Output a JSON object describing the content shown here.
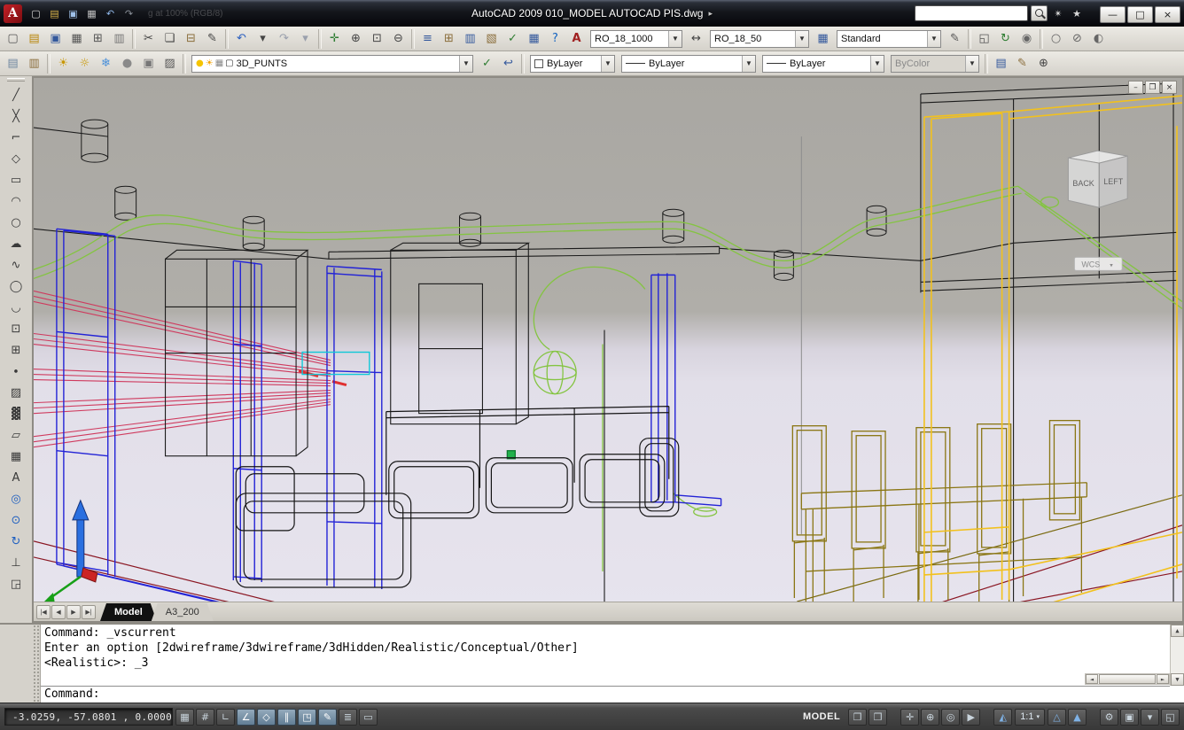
{
  "titlebar": {
    "title": "AutoCAD 2009 010_MODEL AUTOCAD PIS.dwg",
    "title_arrow": "▸",
    "background_text": "g at 100% (RGB/8)",
    "search_value": "",
    "qat": [
      {
        "name": "qnew-icon",
        "glyph": "▢",
        "color": "#d8d8d8"
      },
      {
        "name": "open-icon",
        "glyph": "▤",
        "color": "#d8b24a"
      },
      {
        "name": "save-icon",
        "glyph": "▣",
        "color": "#9fc0e8"
      },
      {
        "name": "plot-icon",
        "glyph": "▦",
        "color": "#c0c0c0"
      },
      {
        "name": "undo-icon",
        "glyph": "↶",
        "color": "#8fb6e8"
      },
      {
        "name": "redo-icon",
        "glyph": "↷",
        "color": "#8a8f98"
      }
    ],
    "comm_center_glyph": "✴",
    "favorites_glyph": "★",
    "window_buttons": [
      {
        "name": "minimize-button",
        "glyph": "—"
      },
      {
        "name": "maximize-button",
        "glyph": "□"
      },
      {
        "name": "close-button",
        "glyph": "×"
      }
    ]
  },
  "toolbar1": {
    "left_icons": [
      {
        "name": "qnew-icon",
        "glyph": "▢",
        "color": "#555555"
      },
      {
        "name": "open-icon",
        "glyph": "▤",
        "color": "#b8860b"
      },
      {
        "name": "save-icon",
        "glyph": "▣",
        "color": "#33589c"
      },
      {
        "name": "plot-icon",
        "glyph": "▦",
        "color": "#555555"
      },
      {
        "name": "plot-preview-icon",
        "glyph": "⊞",
        "color": "#555555"
      },
      {
        "name": "publish-icon",
        "glyph": "▥",
        "color": "#777777"
      },
      {
        "sep": true
      },
      {
        "name": "cut-icon",
        "glyph": "✂",
        "color": "#444444"
      },
      {
        "name": "copy-icon",
        "glyph": "❏",
        "color": "#444444"
      },
      {
        "name": "paste-icon",
        "glyph": "⊟",
        "color": "#8a6d3b"
      },
      {
        "name": "match-properties-icon",
        "glyph": "✎",
        "color": "#444444"
      },
      {
        "sep": true
      },
      {
        "name": "undo-icon",
        "glyph": "↶",
        "color": "#2b5fbf"
      },
      {
        "name": "undo-dropdown-icon",
        "glyph": "▾",
        "color": "#444444"
      },
      {
        "name": "redo-icon",
        "glyph": "↷",
        "color": "#9aa0ad"
      },
      {
        "name": "redo-dropdown-icon",
        "glyph": "▾",
        "color": "#9aa0ad"
      },
      {
        "sep": true
      },
      {
        "name": "pan-icon",
        "glyph": "✛",
        "color": "#2e7d32"
      },
      {
        "name": "zoom-realtime-icon",
        "glyph": "⊕",
        "color": "#444444"
      },
      {
        "name": "zoom-window-icon",
        "glyph": "⊡",
        "color": "#444444"
      },
      {
        "name": "zoom-previous-icon",
        "glyph": "⊖",
        "color": "#444444"
      },
      {
        "sep": true
      },
      {
        "name": "properties-icon",
        "glyph": "≡",
        "color": "#33589c"
      },
      {
        "name": "designcenter-icon",
        "glyph": "⊞",
        "color": "#8a6d3b"
      },
      {
        "name": "tool-palettes-icon",
        "glyph": "▥",
        "color": "#33589c"
      },
      {
        "name": "sheet-set-manager-icon",
        "glyph": "▧",
        "color": "#8a6d3b"
      },
      {
        "name": "markup-icon",
        "glyph": "✓",
        "color": "#2e7d32"
      },
      {
        "name": "quickcalc-icon",
        "glyph": "▦",
        "color": "#33589c"
      },
      {
        "name": "help-icon",
        "glyph": "?",
        "color": "#1565c0"
      }
    ],
    "text_style_icon": "A",
    "text_style_value": "RO_18_1000",
    "dim_style_icon": "↔",
    "dim_style_value": "RO_18_50",
    "table_style_icon": "▦",
    "table_style_value": "Standard",
    "right_icons": [
      {
        "name": "dim-update-icon",
        "glyph": "✎",
        "color": "#555555"
      },
      {
        "sep": true
      },
      {
        "name": "named-views-icon",
        "glyph": "◱",
        "color": "#555555"
      },
      {
        "name": "3d-orbit-icon",
        "glyph": "↻",
        "color": "#2e7d32"
      },
      {
        "name": "render-icon",
        "glyph": "◉",
        "color": "#666666"
      },
      {
        "sep": true
      },
      {
        "name": "sphere-icon",
        "glyph": "○",
        "color": "#666666"
      },
      {
        "name": "no-shadow-icon",
        "glyph": "⊘",
        "color": "#666666"
      },
      {
        "name": "materials-icon",
        "glyph": "◐",
        "color": "#666666"
      }
    ]
  },
  "toolbar2": {
    "left_icons": [
      {
        "name": "layer-properties-manager-icon",
        "glyph": "▤",
        "color": "#6f87a0"
      },
      {
        "name": "layer-states-manager-icon",
        "glyph": "▥",
        "color": "#8a6d3b"
      },
      {
        "sep": true
      },
      {
        "name": "layer-isolate-icon",
        "glyph": "☀",
        "color": "#c89600"
      },
      {
        "name": "layer-unisolate-icon",
        "glyph": "☼",
        "color": "#c89600"
      },
      {
        "name": "layer-freeze-icon",
        "glyph": "❄",
        "color": "#4a90d9"
      },
      {
        "name": "layer-off-icon",
        "glyph": "●",
        "color": "#8a8a8a"
      },
      {
        "name": "layer-lock-icon",
        "glyph": "▣",
        "color": "#777777"
      },
      {
        "name": "layer-walk-icon",
        "glyph": "▨",
        "color": "#555555"
      },
      {
        "sep": true
      }
    ],
    "layer_combo": {
      "icons": [
        {
          "name": "bulb-on-icon",
          "glyph": "●",
          "color": "#f5c400"
        },
        {
          "name": "sun-icon",
          "glyph": "☀",
          "color": "#f5a300"
        },
        {
          "name": "plot-state-icon",
          "glyph": "▦",
          "color": "#888888"
        },
        {
          "name": "layer-color-swatch",
          "glyph": "▢",
          "color": "#333333"
        }
      ],
      "value": "3D_PUNTS"
    },
    "mid_icons": [
      {
        "name": "make-object-layer-current-icon",
        "glyph": "✓",
        "color": "#2e7d32"
      },
      {
        "name": "layer-previous-icon",
        "glyph": "↩",
        "color": "#33589c"
      },
      {
        "sep": true
      }
    ],
    "color_value": "ByLayer",
    "linetype_value": "ByLayer",
    "lineweight_value": "ByLayer",
    "plotstyle_value": "ByColor",
    "right_icons": [
      {
        "sep": true
      },
      {
        "name": "properties-palette-icon",
        "glyph": "▤",
        "color": "#33589c"
      },
      {
        "name": "match-layer-icon",
        "glyph": "✎",
        "color": "#8a6d3b"
      },
      {
        "name": "zoom-to-object-icon",
        "glyph": "⊕",
        "color": "#444444"
      }
    ]
  },
  "left_toolbar": {
    "items": [
      {
        "name": "line-icon",
        "glyph": "╱"
      },
      {
        "name": "construction-line-icon",
        "glyph": "╳"
      },
      {
        "name": "polyline-icon",
        "glyph": "⌐"
      },
      {
        "name": "polygon-icon",
        "glyph": "◇"
      },
      {
        "name": "rectangle-icon",
        "glyph": "▭"
      },
      {
        "name": "arc-icon",
        "glyph": "◠"
      },
      {
        "name": "circle-icon",
        "glyph": "○"
      },
      {
        "name": "revision-cloud-icon",
        "glyph": "☁"
      },
      {
        "name": "spline-icon",
        "glyph": "∿"
      },
      {
        "name": "ellipse-icon",
        "glyph": "◯"
      },
      {
        "name": "ellipse-arc-icon",
        "glyph": "◡"
      },
      {
        "name": "insert-block-icon",
        "glyph": "⊡"
      },
      {
        "name": "make-block-icon",
        "glyph": "⊞"
      },
      {
        "name": "point-icon",
        "glyph": "∙"
      },
      {
        "name": "hatch-icon",
        "glyph": "▨"
      },
      {
        "name": "gradient-icon",
        "glyph": "▓"
      },
      {
        "name": "region-icon",
        "glyph": "▱"
      },
      {
        "name": "table-icon",
        "glyph": "▦"
      },
      {
        "name": "multiline-text-icon",
        "glyph": "A"
      },
      {
        "name": "donut-icon",
        "glyph": "◎",
        "color": "#2060c0"
      },
      {
        "name": "constrained-orbit-icon",
        "glyph": "⊙",
        "color": "#2060c0"
      },
      {
        "name": "free-orbit-icon",
        "glyph": "↻",
        "color": "#2060c0"
      },
      {
        "name": "ucs-tool-icon",
        "glyph": "⊥"
      },
      {
        "name": "named-views-icon",
        "glyph": "◲"
      }
    ]
  },
  "doc_buttons": [
    {
      "name": "minimize-document-button",
      "glyph": "–"
    },
    {
      "name": "restore-document-button",
      "glyph": "❐"
    },
    {
      "name": "close-document-button",
      "glyph": "×"
    }
  ],
  "viewcube": {
    "back_label": "BACK",
    "left_label": "LEFT",
    "wcs_label": "WCS",
    "wcs_arrow": "▾"
  },
  "tabs": {
    "nav": [
      {
        "name": "tab-scroll-first-button",
        "glyph": "|◀"
      },
      {
        "name": "tab-scroll-prev-button",
        "glyph": "◀"
      },
      {
        "name": "tab-scroll-next-button",
        "glyph": "▶"
      },
      {
        "name": "tab-scroll-last-button",
        "glyph": "▶|"
      }
    ],
    "model_label": "Model",
    "layout_label": "A3_200"
  },
  "command": {
    "history": [
      {
        "text": "Command: _vscurrent"
      },
      {
        "text": "Enter an option [2dwireframe/3dwireframe/3dHidden/Realistic/Conceptual/Other]"
      },
      {
        "text": "<Realistic>: _3"
      }
    ],
    "prompt": "Command:"
  },
  "scroll": {
    "up": "▲",
    "down": "▼",
    "left": "◄",
    "right": "►"
  },
  "statusbar": {
    "coords": "-3.0259, -57.0801 , 0.0000",
    "toggles": [
      {
        "name": "snap-toggle",
        "glyph": "▦"
      },
      {
        "name": "grid-toggle",
        "glyph": "#"
      },
      {
        "name": "ortho-toggle",
        "glyph": "∟"
      },
      {
        "name": "polar-toggle",
        "glyph": "∠",
        "pressed": true
      },
      {
        "name": "osnap-toggle",
        "glyph": "◇",
        "pressed": true
      },
      {
        "name": "otrack-toggle",
        "glyph": "∥",
        "pressed": true
      },
      {
        "name": "ducs-toggle",
        "glyph": "◳",
        "pressed": true
      },
      {
        "name": "dyn-toggle",
        "glyph": "✎",
        "pressed": true
      },
      {
        "name": "lwt-toggle",
        "glyph": "≣"
      },
      {
        "name": "qp-toggle",
        "glyph": "▭"
      }
    ],
    "model_label": "MODEL",
    "view_buttons": [
      {
        "name": "quick-view-layouts-button",
        "glyph": "❐"
      },
      {
        "name": "quick-view-drawings-button",
        "glyph": "❒"
      }
    ],
    "nav_buttons": [
      {
        "name": "pan-button",
        "glyph": "✛"
      },
      {
        "name": "zoom-button",
        "glyph": "⊕"
      },
      {
        "name": "steering-wheel-button",
        "glyph": "◎"
      },
      {
        "name": "showmotion-button",
        "glyph": "▶"
      }
    ],
    "annotation_buttons": [
      {
        "name": "annotation-scale-icon",
        "glyph": "◭",
        "color": "#7fb2e5"
      }
    ],
    "scale_label": "1:1",
    "scale_arrow": "▾",
    "annotation_buttons2": [
      {
        "name": "annotation-visibility-button",
        "glyph": "△",
        "color": "#7fb2e5"
      },
      {
        "name": "annotation-autoscale-button",
        "glyph": "▲",
        "color": "#7fb2e5"
      }
    ],
    "right_buttons": [
      {
        "name": "workspace-switching-button",
        "glyph": "⚙"
      },
      {
        "name": "toolbar-lock-button",
        "glyph": "▣"
      },
      {
        "name": "status-menu-button",
        "glyph": "▾"
      },
      {
        "name": "clean-screen-button",
        "glyph": "◱"
      }
    ]
  }
}
